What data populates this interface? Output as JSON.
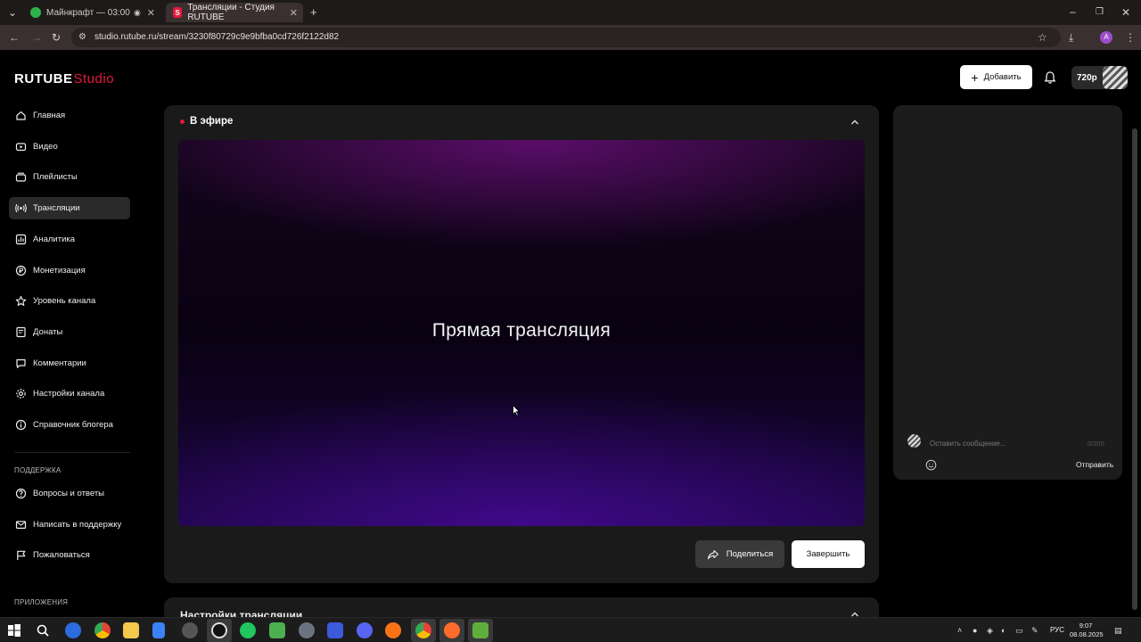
{
  "browser": {
    "tabs": [
      {
        "title": "Майнкрафт — 03:00",
        "favicon_color": "#2fb24c"
      },
      {
        "title": "Трансляции - Студия RUTUBE",
        "favicon_color": "#e6193c",
        "favicon_letter": "S"
      }
    ],
    "new_tab": "+",
    "url": "studio.rutube.ru/stream/3230f80729c9e9bfba0cd726f2122d82"
  },
  "logo": {
    "brand": "RUTUBE",
    "product": "Studio"
  },
  "sidebar": {
    "items": [
      {
        "label": "Главная",
        "icon": "home-icon"
      },
      {
        "label": "Видео",
        "icon": "video-icon"
      },
      {
        "label": "Плейлисты",
        "icon": "playlist-icon"
      },
      {
        "label": "Трансляции",
        "icon": "broadcast-icon",
        "active": true
      },
      {
        "label": "Аналитика",
        "icon": "analytics-icon"
      },
      {
        "label": "Монетизация",
        "icon": "monetization-icon"
      },
      {
        "label": "Уровень канала",
        "icon": "star-icon"
      },
      {
        "label": "Донаты",
        "icon": "donate-icon"
      },
      {
        "label": "Комментарии",
        "icon": "comment-icon"
      },
      {
        "label": "Настройки канала",
        "icon": "gear-icon"
      },
      {
        "label": "Справочник блогера",
        "icon": "info-icon"
      }
    ],
    "support_label": "ПОДДЕРЖКА",
    "support_items": [
      {
        "label": "Вопросы и ответы",
        "icon": "question-icon"
      },
      {
        "label": "Написать в поддержку",
        "icon": "mail-icon"
      },
      {
        "label": "Пожаловаться",
        "icon": "flag-icon"
      }
    ],
    "apps_label": "ПРИЛОЖЕНИЯ"
  },
  "header": {
    "add_label": "Добавить",
    "quality": "720p"
  },
  "live": {
    "title": "В эфире",
    "player_text": "Прямая трансляция",
    "share_label": "Поделиться",
    "end_label": "Завершить"
  },
  "settings": {
    "title": "Настройки трансляции"
  },
  "chat": {
    "placeholder": "Оставить сообщение...",
    "counter": "0/200",
    "send_label": "Отправить"
  },
  "taskbar": {
    "language": "РУС",
    "time": "9:07",
    "date": "08.08.2025"
  },
  "colors": {
    "accent": "#e6193c",
    "card": "#1a1a1a",
    "background": "#000000"
  }
}
